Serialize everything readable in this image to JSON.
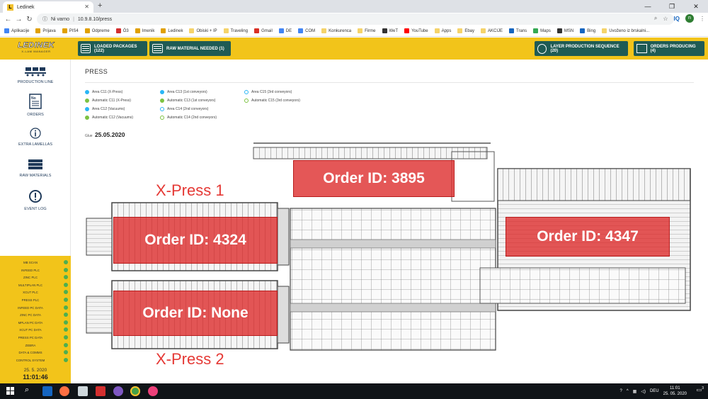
{
  "browser": {
    "tab_title": "Ledinek",
    "tab_favicon": "L",
    "security_label": "Ni varno",
    "url": "10.9.8.10/press",
    "iq_label": "IQ",
    "avatar_initial": "n"
  },
  "bookmarks": [
    {
      "label": "Aplikacije",
      "color": "#4285f4"
    },
    {
      "label": "Prijava",
      "color": "#e0a000"
    },
    {
      "label": "PIS4",
      "color": "#e0a000"
    },
    {
      "label": "Odpreme",
      "color": "#e0a000"
    },
    {
      "label": "Ö3",
      "color": "#d32f2f"
    },
    {
      "label": "Imenik",
      "color": "#e0a000"
    },
    {
      "label": "Ledinek",
      "color": "#e0a000"
    },
    {
      "label": "Obiski + IP",
      "color": "#f5d36b"
    },
    {
      "label": "Traveling",
      "color": "#f5d36b"
    },
    {
      "label": "Gmail",
      "color": "#d93025"
    },
    {
      "label": "DE",
      "color": "#4285f4"
    },
    {
      "label": "COM",
      "color": "#4285f4"
    },
    {
      "label": "Konkurenca",
      "color": "#f5d36b"
    },
    {
      "label": "Firme",
      "color": "#f5d36b"
    },
    {
      "label": "WeT",
      "color": "#333333"
    },
    {
      "label": "YouTube",
      "color": "#ff0000"
    },
    {
      "label": "Apps",
      "color": "#f5d36b"
    },
    {
      "label": "Ebay",
      "color": "#f5d36b"
    },
    {
      "label": "AKCIJE",
      "color": "#f5d36b"
    },
    {
      "label": "Trans",
      "color": "#1565c0"
    },
    {
      "label": "Maps",
      "color": "#34a853"
    },
    {
      "label": "MSN",
      "color": "#333333"
    },
    {
      "label": "Bing",
      "color": "#1565c0"
    },
    {
      "label": "Uvoženo iz brskalni...",
      "color": "#f5d36b"
    }
  ],
  "header": {
    "logo_text": "LEDINEK",
    "logo_sub": "X-LAM MANAGER",
    "loaded_packages": "LOADED PACKAGES (122)",
    "raw_material_needed": "RAW MATERIAL NEEDED (1)",
    "layer_production_sequence": "LAYER PRODUCTION SEQUENCE (20)",
    "orders_producing": "ORDERS PRODUCING (4)"
  },
  "sidebar": {
    "production_line": "PRODUCTION LINE",
    "orders": "ORDERS",
    "extra_lamellas": "EXTRA LAMELLAS",
    "raw_materials": "RAW MATERIALS",
    "event_log": "EVENT LOG"
  },
  "status": [
    "MB SCAN",
    "INFEED PLC",
    "ZINC PLC",
    "MULTIPLAN PLC",
    "XCUT PLC",
    "PRESS PLC",
    "INFEED PC DATA",
    "ZINC PC DATA",
    "MPLAN PC DATA",
    "XCUT PC DATA",
    "PRESS PC DATA",
    "ZEBRA",
    "DATA & COMMS",
    "CONTROL SYSTEM"
  ],
  "status_color": "#4caf50",
  "clock": {
    "date": "25. 5. 2020",
    "time": "11:01:46"
  },
  "page": {
    "title": "PRESS",
    "glue_label": "Glue",
    "glue_date": "25.05.2020"
  },
  "legend": [
    {
      "label": "Area C11 (X-Press)",
      "color": "#29b6f6",
      "filled": true
    },
    {
      "label": "Automatic C11 (X-Press)",
      "color": "#7cc242",
      "filled": true
    },
    {
      "label": "Area C12 (Vacuums)",
      "color": "#29b6f6",
      "filled": true
    },
    {
      "label": "Automatic C12 (Vacuums)",
      "color": "#7cc242",
      "filled": true
    },
    {
      "label": "Area C13 (1st conveyors)",
      "color": "#29b6f6",
      "filled": true
    },
    {
      "label": "Automatic C13 (1st conveyors)",
      "color": "#7cc242",
      "filled": true
    },
    {
      "label": "Area C14 (2nd conveyors)",
      "color": "#29b6f6",
      "filled": false
    },
    {
      "label": "Automatic C14 (2nd conveyors)",
      "color": "#7cc242",
      "filled": false
    },
    {
      "label": "Area C15 (3rd conveyors)",
      "color": "#29b6f6",
      "filled": false
    },
    {
      "label": "Automatic C15 (3rd conveyors)",
      "color": "#7cc242",
      "filled": false
    }
  ],
  "drawing": {
    "xpress1_label": "X-Press 1",
    "xpress2_label": "X-Press 2",
    "order_top": "Order ID: 3895",
    "order_xpress1": "Order ID: 4324",
    "order_xpress2": "Order ID: None",
    "order_right": "Order ID: 4347"
  },
  "taskbar": {
    "language": "DEU",
    "time": "11:01",
    "date": "25. 05. 2020",
    "notification_count": "3"
  }
}
